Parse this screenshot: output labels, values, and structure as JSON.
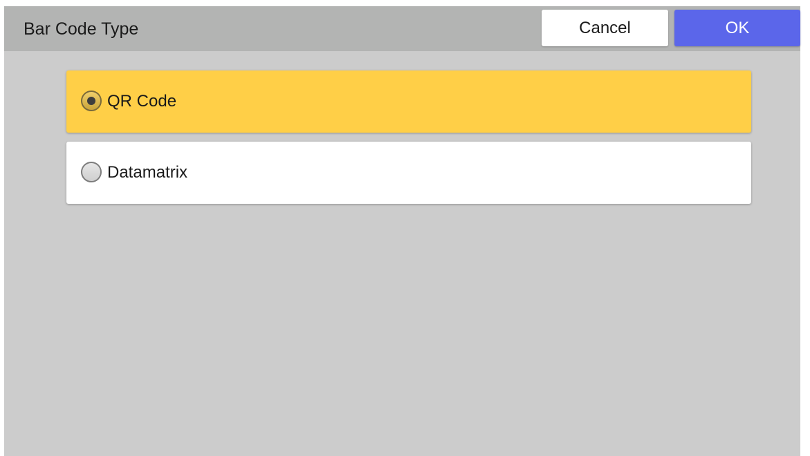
{
  "dialog": {
    "title": "Bar Code Type",
    "cancel_label": "Cancel",
    "ok_label": "OK"
  },
  "options": [
    {
      "label": "QR Code",
      "selected": true
    },
    {
      "label": "Datamatrix",
      "selected": false
    }
  ],
  "colors": {
    "header_bg": "#b3b4b3",
    "body_bg": "#cccccc",
    "selected_bg": "#ffcf47",
    "unselected_bg": "#ffffff",
    "ok_bg": "#5b66ea"
  }
}
